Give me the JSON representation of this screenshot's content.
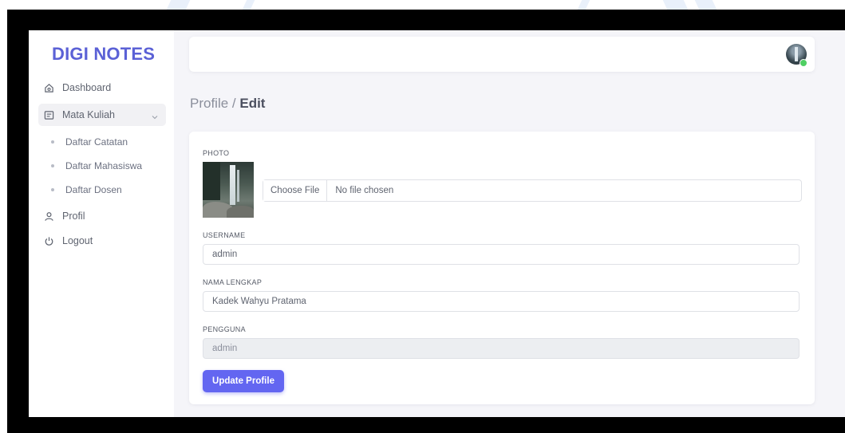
{
  "brand": "DIGI NOTES",
  "sidebar": {
    "items": [
      {
        "label": "Dashboard",
        "icon": "home-icon"
      },
      {
        "label": "Mata Kuliah",
        "icon": "notes-icon"
      },
      {
        "label": "Profil",
        "icon": "user-icon"
      },
      {
        "label": "Logout",
        "icon": "power-icon"
      }
    ],
    "sub_items": [
      {
        "label": "Daftar Catatan"
      },
      {
        "label": "Daftar Mahasiswa"
      },
      {
        "label": "Daftar Dosen"
      }
    ]
  },
  "breadcrumb": {
    "parent": "Profile / ",
    "current": "Edit"
  },
  "form": {
    "photo_label": "PHOTO",
    "file_button": "Choose File",
    "file_status": "No file chosen",
    "username_label": "USERNAME",
    "username_value": "admin",
    "fullname_label": "NAMA LENGKAP",
    "fullname_value": "Kadek Wahyu Pratama",
    "role_label": "PENGGUNA",
    "role_value": "admin",
    "submit_label": "Update Profile"
  },
  "colors": {
    "accent": "#6366f1",
    "brand": "#5b61d6",
    "online_status": "#4fcf63"
  }
}
